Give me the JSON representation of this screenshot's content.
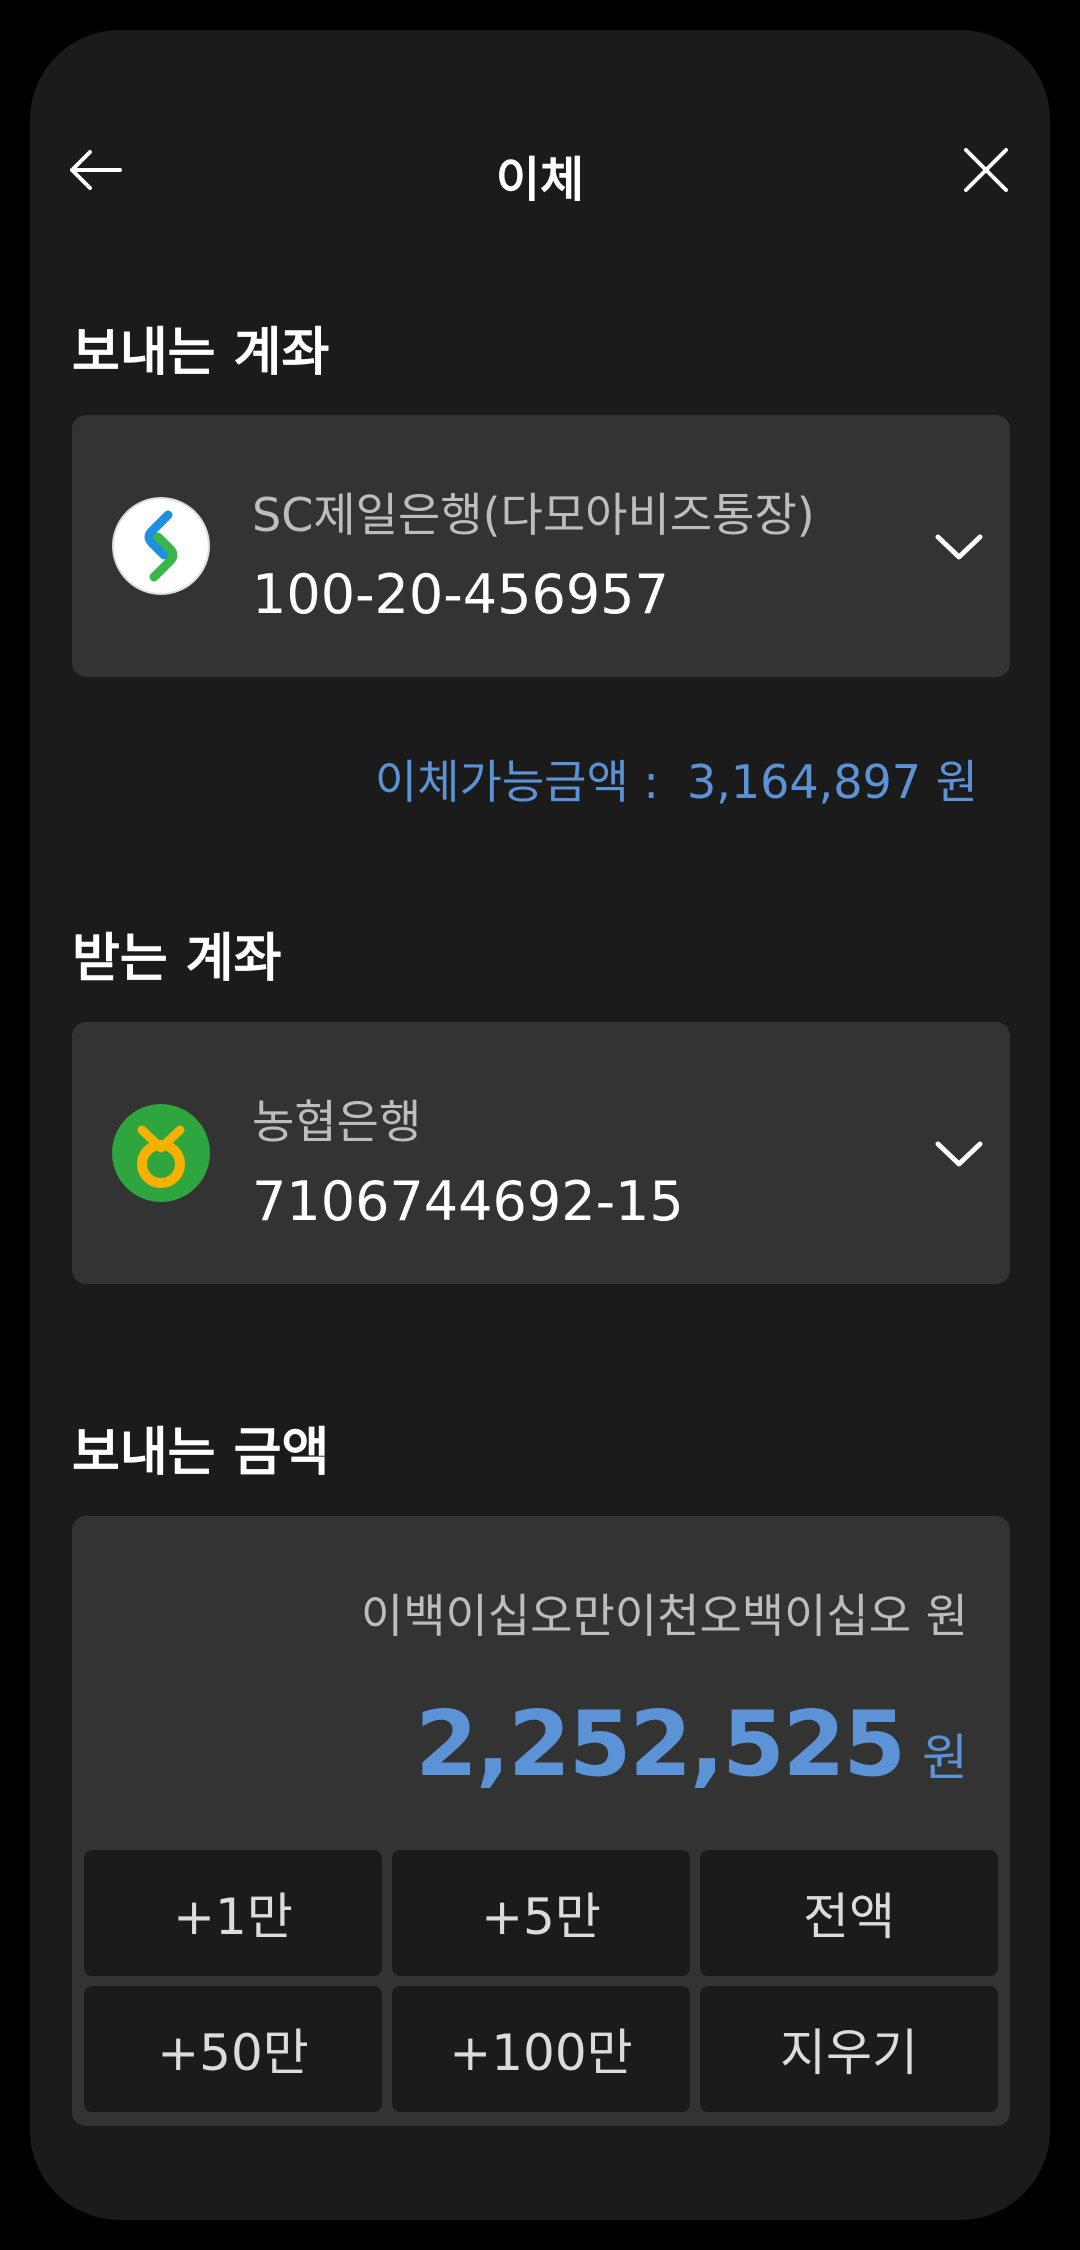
{
  "header": {
    "title": "이체",
    "back_icon": "arrow-left-icon",
    "close_icon": "close-icon"
  },
  "sender": {
    "label": "보내는 계좌",
    "bank_name": "SC제일은행(다모아비즈통장)",
    "account_number": "100-20-456957",
    "logo_icon": "sc-bank-logo-icon",
    "available_label": "이체가능금액 :",
    "available_amount": "3,164,897 원"
  },
  "receiver": {
    "label": "받는 계좌",
    "bank_name": "농협은행",
    "account_number": "7106744692-15",
    "logo_icon": "nh-bank-logo-icon"
  },
  "amount": {
    "label": "보내는 금액",
    "words": "이백이십오만이천오백이십오 원",
    "value": "2,252,525",
    "unit": "원"
  },
  "keypad": [
    [
      "+1만",
      "+5만",
      "전액"
    ],
    [
      "+50만",
      "+100만",
      "지우기"
    ]
  ],
  "colors": {
    "accent": "#5b93d6",
    "background": "#1b1b1b",
    "card": "#333333"
  }
}
